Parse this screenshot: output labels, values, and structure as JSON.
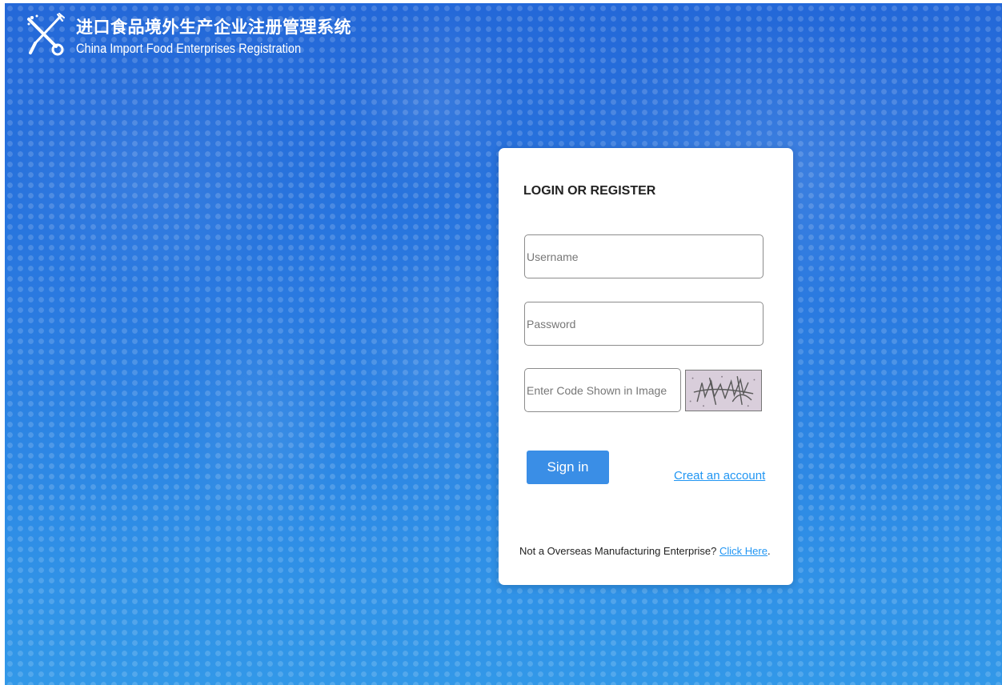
{
  "header": {
    "title_cn": "进口食品境外生产企业注册管理系统",
    "title_en": "China Import Food Enterprises Registration",
    "logo_icon": "knife-fork-logo-icon"
  },
  "login": {
    "heading": "LOGIN OR REGISTER",
    "username_placeholder": "Username",
    "password_placeholder": "Password",
    "code_placeholder": "Enter Code Shown in Image",
    "captcha_icon": "captcha-image",
    "signin_label": "Sign in",
    "create_account_label": "Creat an account",
    "footer_text": "Not a Overseas Manufacturing Enterprise? ",
    "footer_link": "Click Here",
    "footer_end": "."
  },
  "colors": {
    "background_top": "#2468d8",
    "background_bottom": "#3298e8",
    "button": "#3a8ee6",
    "link": "#2196f3"
  }
}
